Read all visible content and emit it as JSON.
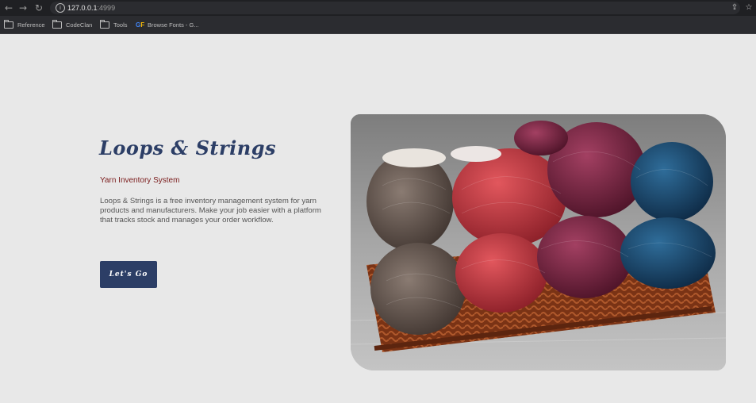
{
  "browser": {
    "url_host": "127.0.0.1",
    "url_port": ":4999",
    "bookmarks": [
      {
        "label": "Reference",
        "icon": "folder-icon"
      },
      {
        "label": "CodeClan",
        "icon": "folder-icon"
      },
      {
        "label": "Tools",
        "icon": "folder-icon"
      },
      {
        "label": "Browse Fonts - G...",
        "icon": "google-fonts-icon"
      }
    ]
  },
  "hero": {
    "title": "Loops & Strings",
    "subtitle": "Yarn Inventory System",
    "description": "Loops & Strings is a free inventory management system for yarn products and manufacturers. Make your job easier with a platform that tracks stock and manages your order workflow.",
    "cta_label": "Let's Go",
    "image": "yarn-basket-image"
  },
  "colors": {
    "accent": "#2c3e66",
    "subtitle": "#7a1b1b",
    "page_bg": "#e8e8e8",
    "chrome_bg": "#1f2023"
  }
}
